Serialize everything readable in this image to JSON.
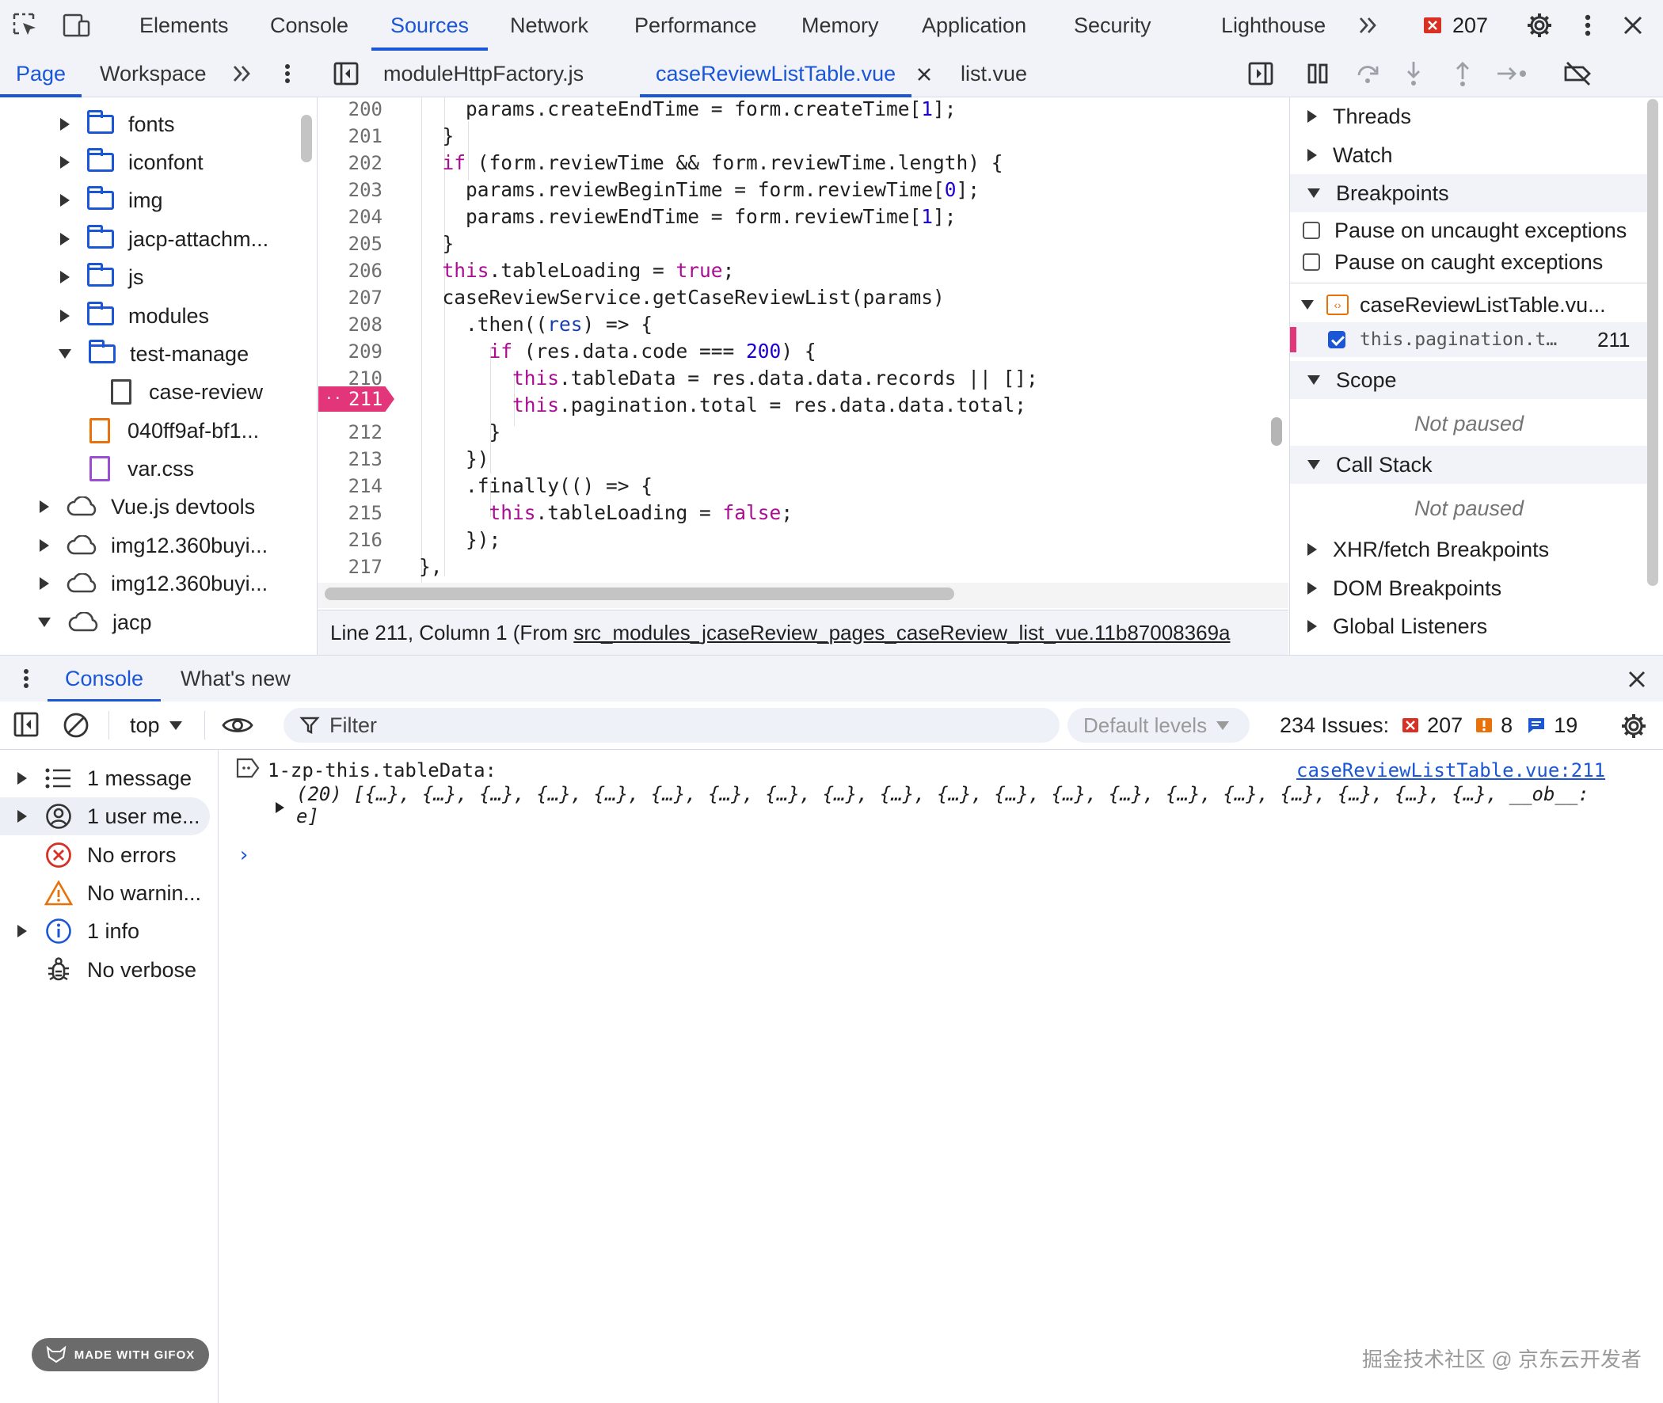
{
  "top_tabs": [
    "Elements",
    "Console",
    "Sources",
    "Network",
    "Performance",
    "Memory",
    "Application",
    "Security",
    "Lighthouse"
  ],
  "top_active": "Sources",
  "error_badge_count": "207",
  "nav_tabs": [
    "Page",
    "Workspace"
  ],
  "nav_active": "Page",
  "editor_tabs": [
    "moduleHttpFactory.js",
    "caseReviewListTable.vue",
    "list.vue"
  ],
  "editor_active": "caseReviewListTable.vue",
  "tree": {
    "items": [
      {
        "label": "fonts",
        "type": "folder",
        "state": "collapsed"
      },
      {
        "label": "iconfont",
        "type": "folder",
        "state": "collapsed"
      },
      {
        "label": "img",
        "type": "folder",
        "state": "collapsed"
      },
      {
        "label": "jacp-attachm...",
        "type": "folder",
        "state": "collapsed"
      },
      {
        "label": "js",
        "type": "folder",
        "state": "collapsed"
      },
      {
        "label": "modules",
        "type": "folder",
        "state": "collapsed"
      },
      {
        "label": "test-manage",
        "type": "folder",
        "state": "expanded"
      },
      {
        "label": "case-review",
        "type": "file"
      },
      {
        "label": "040ff9af-bf1...",
        "type": "file-orange"
      },
      {
        "label": "var.css",
        "type": "file-purple"
      },
      {
        "label": "Vue.js devtools",
        "type": "cloud",
        "state": "collapsed"
      },
      {
        "label": "img12.360buyi...",
        "type": "cloud",
        "state": "collapsed"
      },
      {
        "label": "img12.360buyi...",
        "type": "cloud",
        "state": "collapsed"
      },
      {
        "label": "jacp",
        "type": "cloud",
        "state": "expanded"
      }
    ]
  },
  "editor": {
    "line_numbers": [
      "200",
      "201",
      "202",
      "203",
      "204",
      "205",
      "206",
      "207",
      "208",
      "209",
      "210",
      "211",
      "212",
      "213",
      "214",
      "215",
      "216",
      "217"
    ],
    "breakpoint_line": "211",
    "breakpoint_dots": "··",
    "lines": [
      [
        {
          "t": "    params.createEndTime = form.createTime["
        },
        {
          "t": "1",
          "c": "num"
        },
        {
          "t": "];"
        }
      ],
      [
        {
          "t": "  }"
        }
      ],
      [
        {
          "t": "  "
        },
        {
          "t": "if",
          "c": "kw"
        },
        {
          "t": " (form.reviewTime && form.reviewTime.length) {"
        }
      ],
      [
        {
          "t": "    params.reviewBeginTime = form.reviewTime["
        },
        {
          "t": "0",
          "c": "num"
        },
        {
          "t": "];"
        }
      ],
      [
        {
          "t": "    params.reviewEndTime = form.reviewTime["
        },
        {
          "t": "1",
          "c": "num"
        },
        {
          "t": "];"
        }
      ],
      [
        {
          "t": "  }"
        }
      ],
      [
        {
          "t": "  "
        },
        {
          "t": "this",
          "c": "kw"
        },
        {
          "t": ".tableLoading = "
        },
        {
          "t": "true",
          "c": "kw"
        },
        {
          "t": ";"
        }
      ],
      [
        {
          "t": "  caseReviewService.getCaseReviewList(params)"
        }
      ],
      [
        {
          "t": "    .then(("
        },
        {
          "t": "res",
          "c": "var"
        },
        {
          "t": ") => {"
        }
      ],
      [
        {
          "t": "      "
        },
        {
          "t": "if",
          "c": "kw"
        },
        {
          "t": " (res.data.code === "
        },
        {
          "t": "200",
          "c": "num"
        },
        {
          "t": ") {"
        }
      ],
      [
        {
          "t": "        "
        },
        {
          "t": "this",
          "c": "kw"
        },
        {
          "t": ".tableData = res.data.data.records || [];"
        }
      ],
      [
        {
          "t": "        "
        },
        {
          "t": "this",
          "c": "kw"
        },
        {
          "t": ".pagination.total = res.data.data.total;"
        }
      ],
      [
        {
          "t": "      }"
        }
      ],
      [
        {
          "t": "    })"
        }
      ],
      [
        {
          "t": "    .finally(() => {"
        }
      ],
      [
        {
          "t": "      "
        },
        {
          "t": "this",
          "c": "kw"
        },
        {
          "t": ".tableLoading = "
        },
        {
          "t": "false",
          "c": "kw"
        },
        {
          "t": ";"
        }
      ],
      [
        {
          "t": "    });"
        }
      ],
      [
        {
          "t": "},"
        }
      ]
    ],
    "status_prefix": "Line 211, Column 1  (From ",
    "status_link": "src_modules_jcaseReview_pages_caseReview_list_vue.11b87008369a"
  },
  "debugger": {
    "threads": "Threads",
    "watch": "Watch",
    "breakpoints": "Breakpoints",
    "pause_uncaught": "Pause on uncaught exceptions",
    "pause_caught": "Pause on caught exceptions",
    "bp_file": "caseReviewListTable.vu...",
    "bp_code": "this.pagination.t…",
    "bp_line": "211",
    "scope": "Scope",
    "scope_status": "Not paused",
    "call_stack": "Call Stack",
    "call_status": "Not paused",
    "xhr": "XHR/fetch Breakpoints",
    "dom": "DOM Breakpoints",
    "global": "Global Listeners"
  },
  "drawer": {
    "tabs": [
      "Console",
      "What's new"
    ],
    "active": "Console",
    "context": "top",
    "filter_placeholder": "Filter",
    "levels": "Default levels",
    "issues_label": "234 Issues:",
    "issues_errors": "207",
    "issues_warnings": "8",
    "issues_info": "19"
  },
  "console_sidebar": [
    {
      "label": "1 message",
      "icon": "list-icon",
      "expandable": true
    },
    {
      "label": "1 user me...",
      "icon": "user-icon",
      "expandable": true,
      "selected": true
    },
    {
      "label": "No errors",
      "icon": "error-icon",
      "expandable": false
    },
    {
      "label": "No warnin...",
      "icon": "warning-icon",
      "expandable": false
    },
    {
      "label": "1 info",
      "icon": "info-icon",
      "expandable": true
    },
    {
      "label": "No verbose",
      "icon": "bug-icon",
      "expandable": false
    }
  ],
  "console_log": {
    "message": "1-zp-this.tableData:",
    "source": "caseReviewListTable.vue:211",
    "array_line1": "(20) [{…}, {…}, {…}, {…}, {…}, {…}, {…}, {…}, {…}, {…}, {…}, {…}, {…}, {…}, {…}, {…}, {…}, {…}, {…}, {…}, __ob__:",
    "array_line2": "e]",
    "prompt": "›"
  },
  "gifox": "MADE WITH GIFOX",
  "watermark": "掘金技术社区 @ 京东云开发者",
  "colors": {
    "accent": "#1a56d6",
    "breakpoint": "#e3357a",
    "error": "#d93025",
    "warning": "#e8710a",
    "keyword": "#aa0d91",
    "number": "#1c00cf"
  }
}
